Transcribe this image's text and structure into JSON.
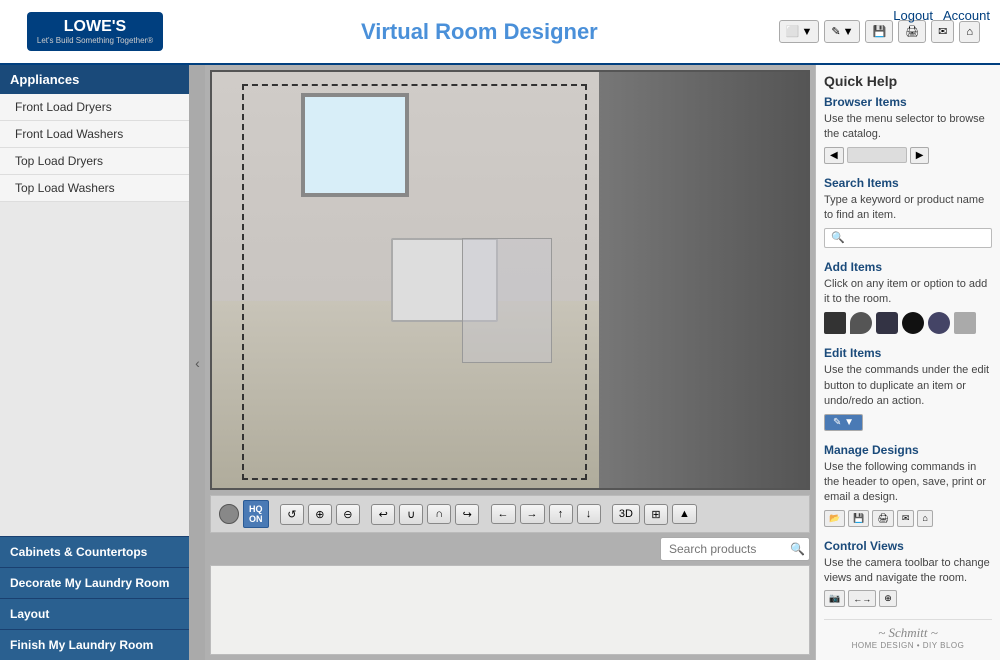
{
  "header": {
    "logo_line1": "LOWE'S",
    "logo_line2": "Let's Build Something Together®",
    "title": "Virtual Room Designer",
    "actions": {
      "logout": "Logout",
      "account": "Account"
    }
  },
  "toolbar": {
    "view_btn": "▼",
    "edit_btn": "✎▼",
    "save_icon": "💾",
    "print_icon": "🖨",
    "email_icon": "✉",
    "home_icon": "⌂"
  },
  "sidebar": {
    "top_section": "Appliances",
    "items": [
      {
        "label": "Front Load Dryers"
      },
      {
        "label": "Front Load Washers"
      },
      {
        "label": "Top Load Dryers"
      },
      {
        "label": "Top Load Washers"
      }
    ],
    "categories": [
      {
        "label": "Cabinets & Countertops"
      },
      {
        "label": "Decorate My Laundry Room"
      },
      {
        "label": "Layout"
      },
      {
        "label": "Finish My Laundry Room"
      }
    ]
  },
  "viewer": {
    "search_placeholder": "Search products",
    "hq_label": "HQ\nON"
  },
  "right_panel": {
    "title": "Quick Help",
    "browser_items": {
      "heading": "Browser Items",
      "text": "Use the menu selector to browse the catalog."
    },
    "search_items": {
      "heading": "Search Items",
      "text": "Type a keyword or product name to find an item."
    },
    "add_items": {
      "heading": "Add Items",
      "text": "Click on any item or option to add it to the room."
    },
    "edit_items": {
      "heading": "Edit Items",
      "text": "Use the commands under the edit button to duplicate an item or undo/redo an action."
    },
    "manage_designs": {
      "heading": "Manage Designs",
      "text": "Use the following commands in the header to open, save, print or email a design."
    },
    "control_views": {
      "heading": "Control Views",
      "text": "Use the camera toolbar to change views and navigate the room."
    },
    "blog": "HOME DESIGN • DIY BLOG"
  }
}
